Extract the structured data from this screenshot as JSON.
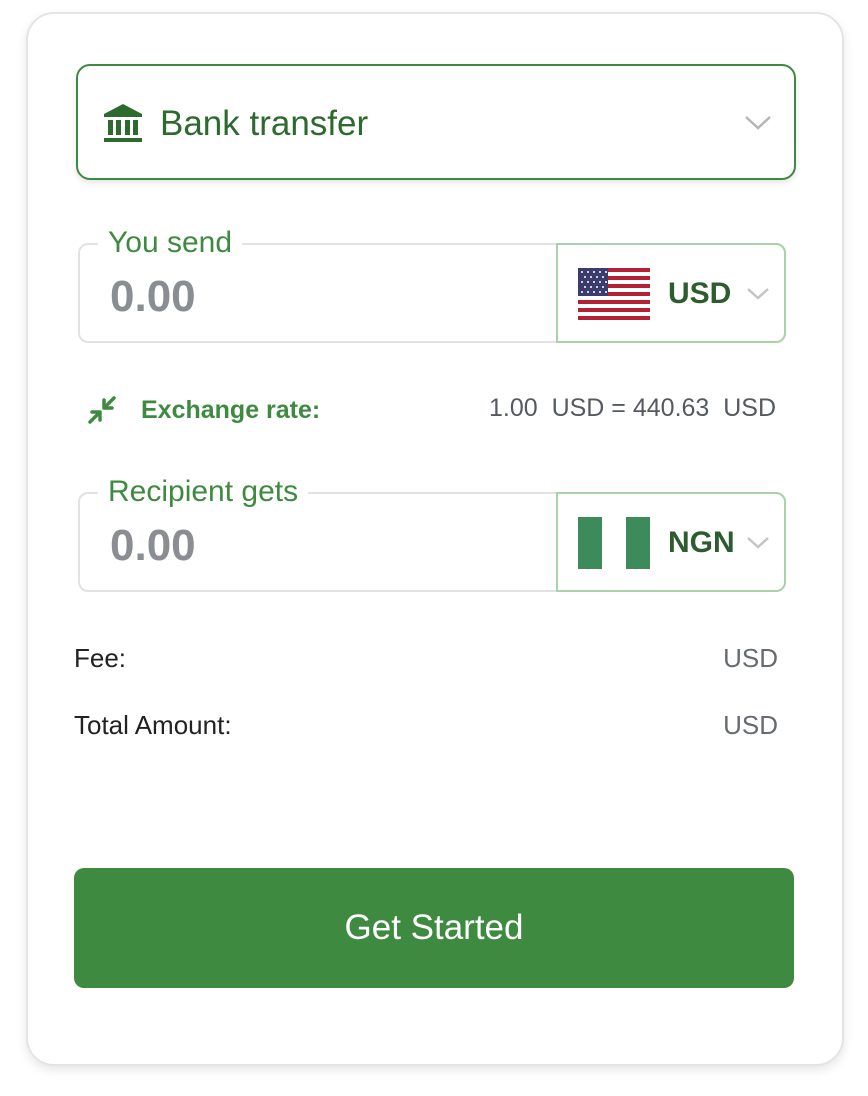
{
  "method_select": {
    "icon": "bank-icon",
    "label": "Bank transfer"
  },
  "send": {
    "legend": "You send",
    "amount_placeholder": "0.00",
    "currency": {
      "code": "USD",
      "flag": "us-flag"
    }
  },
  "exchange": {
    "icon": "arrows-compress-icon",
    "label": "Exchange rate:",
    "value": "1.00  USD = 440.63  USD"
  },
  "receive": {
    "legend": "Recipient gets",
    "amount_placeholder": "0.00",
    "currency": {
      "code": "NGN",
      "flag": "ng-flag"
    }
  },
  "summary": {
    "fee_label": "Fee:",
    "fee_value": "USD",
    "total_label": "Total Amount:",
    "total_value": "USD"
  },
  "cta_label": "Get Started",
  "colors": {
    "accent": "#3e8a40",
    "accent_dark": "#2d6a2f",
    "border_light": "#a9d2ab"
  }
}
